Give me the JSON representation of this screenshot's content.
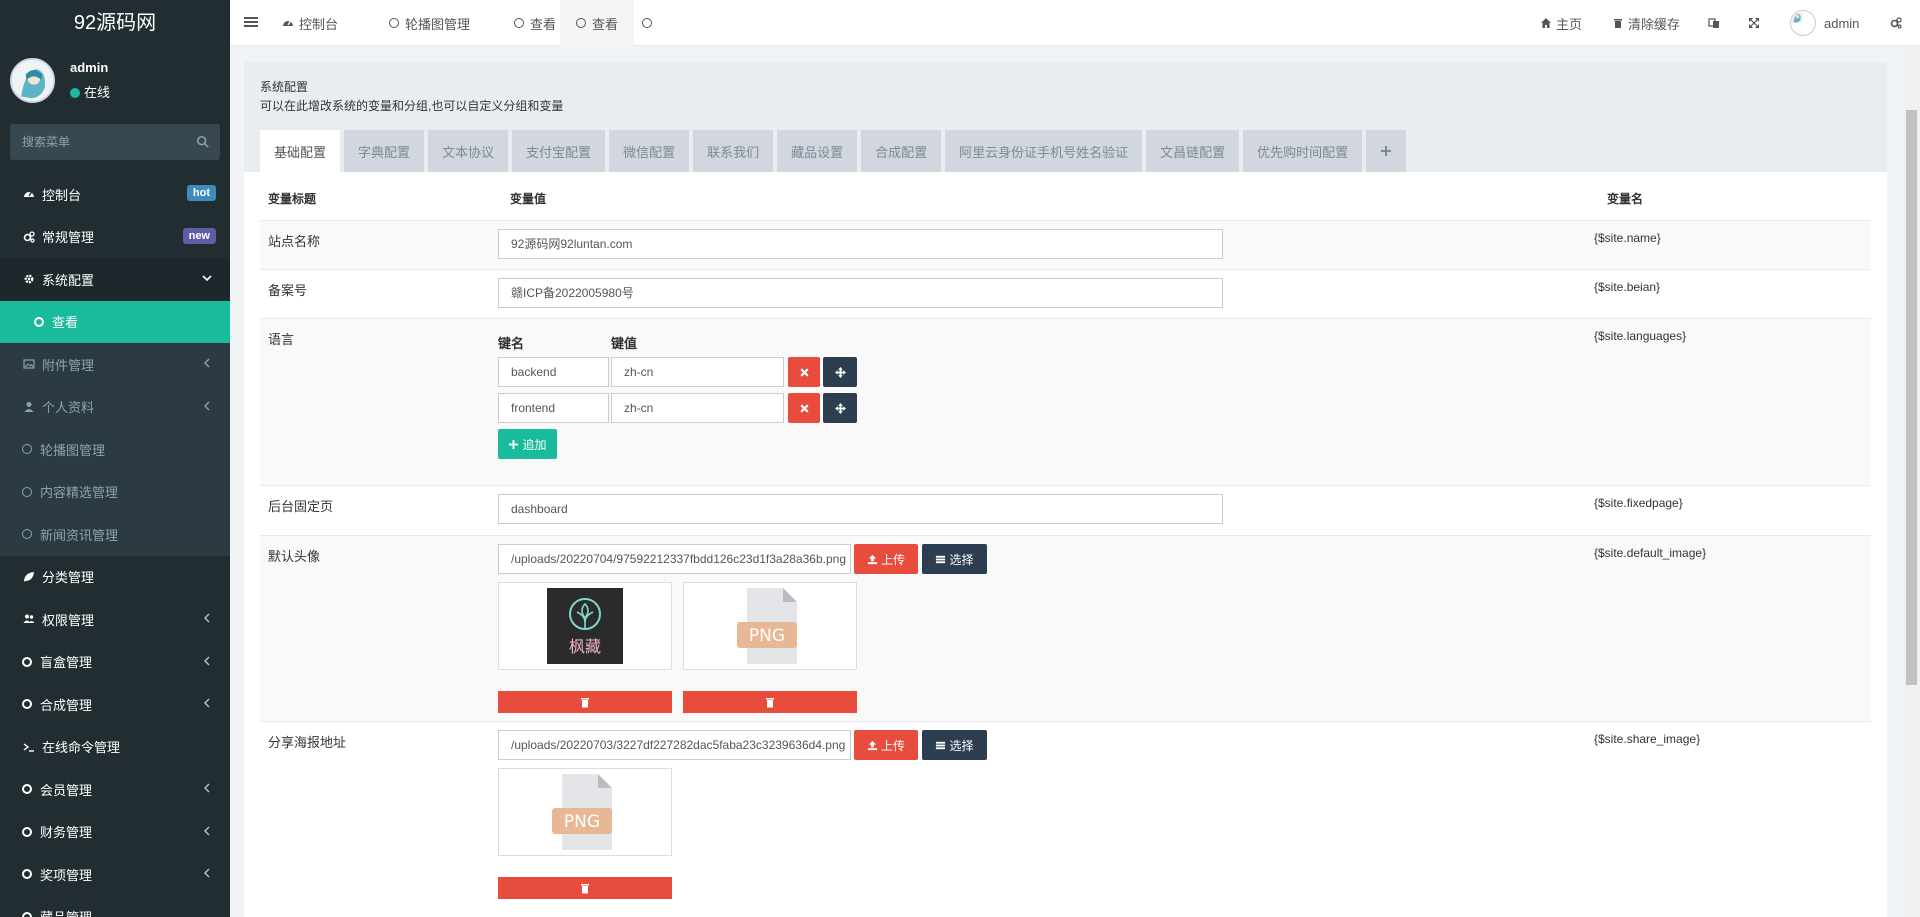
{
  "app": {
    "logo_text": "92源码网"
  },
  "user": {
    "name": "admin",
    "status": "在线"
  },
  "search": {
    "placeholder": "搜索菜单"
  },
  "sidebar": {
    "items": [
      {
        "label": "控制台",
        "badge": "hot"
      },
      {
        "label": "常规管理",
        "badge": "new"
      },
      {
        "label": "系统配置"
      },
      {
        "label": "查看"
      },
      {
        "label": "附件管理"
      },
      {
        "label": "个人资料"
      },
      {
        "label": "轮播图管理"
      },
      {
        "label": "内容精选管理"
      },
      {
        "label": "新闻资讯管理"
      },
      {
        "label": "分类管理"
      },
      {
        "label": "权限管理"
      },
      {
        "label": "盲盒管理"
      },
      {
        "label": "合成管理"
      },
      {
        "label": "在线命令管理"
      },
      {
        "label": "会员管理"
      },
      {
        "label": "财务管理"
      },
      {
        "label": "奖项管理"
      },
      {
        "label": "藏品管理"
      }
    ]
  },
  "topbar": {
    "tabs": [
      {
        "label": "控制台"
      },
      {
        "label": "轮播图管理"
      },
      {
        "label": "查看"
      },
      {
        "label": "查看"
      }
    ],
    "home": "主页",
    "clear_cache": "清除缓存",
    "admin": "admin"
  },
  "panel": {
    "title": "系统配置",
    "description": "可以在此增改系统的变量和分组,也可以自定义分组和变量",
    "tabs": [
      "基础配置",
      "字典配置",
      "文本协议",
      "支付宝配置",
      "微信配置",
      "联系我们",
      "藏品设置",
      "合成配置",
      "阿里云身份证手机号姓名验证",
      "文昌链配置",
      "优先购时间配置"
    ]
  },
  "table": {
    "headers": {
      "title": "变量标题",
      "value": "变量值",
      "name": "变量名"
    },
    "rows": {
      "site_name": {
        "title": "站点名称",
        "value": "92源码网92luntan.com",
        "var": "{$site.name}"
      },
      "beian": {
        "title": "备案号",
        "value": "赣ICP备2022005980号",
        "var": "{$site.beian}"
      },
      "languages": {
        "title": "语言",
        "var": "{$site.languages}",
        "key_label": "键名",
        "value_label": "键值",
        "entries": [
          {
            "key": "backend",
            "value": "zh-cn"
          },
          {
            "key": "frontend",
            "value": "zh-cn"
          }
        ],
        "add_label": "追加"
      },
      "fixedpage": {
        "title": "后台固定页",
        "value": "dashboard",
        "var": "{$site.fixedpage}"
      },
      "default_image": {
        "title": "默认头像",
        "value": "/uploads/20220704/97592212337fbdd126c23d1f3a28a36b.png",
        "var": "{$site.default_image}",
        "upload": "上传",
        "choose": "选择",
        "thumb_text": "枫藏",
        "png_text": "PNG"
      },
      "share_image": {
        "title": "分享海报地址",
        "value": "/uploads/20220703/3227df227282dac5faba23c3239636d4.png",
        "var": "{$site.share_image}",
        "upload": "上传",
        "choose": "选择",
        "png_text": "PNG"
      }
    }
  },
  "colors": {
    "accent": "#18bc9c",
    "sidebar_bg": "#222d32",
    "danger": "#e74c3c",
    "dark": "#2c3e50"
  }
}
